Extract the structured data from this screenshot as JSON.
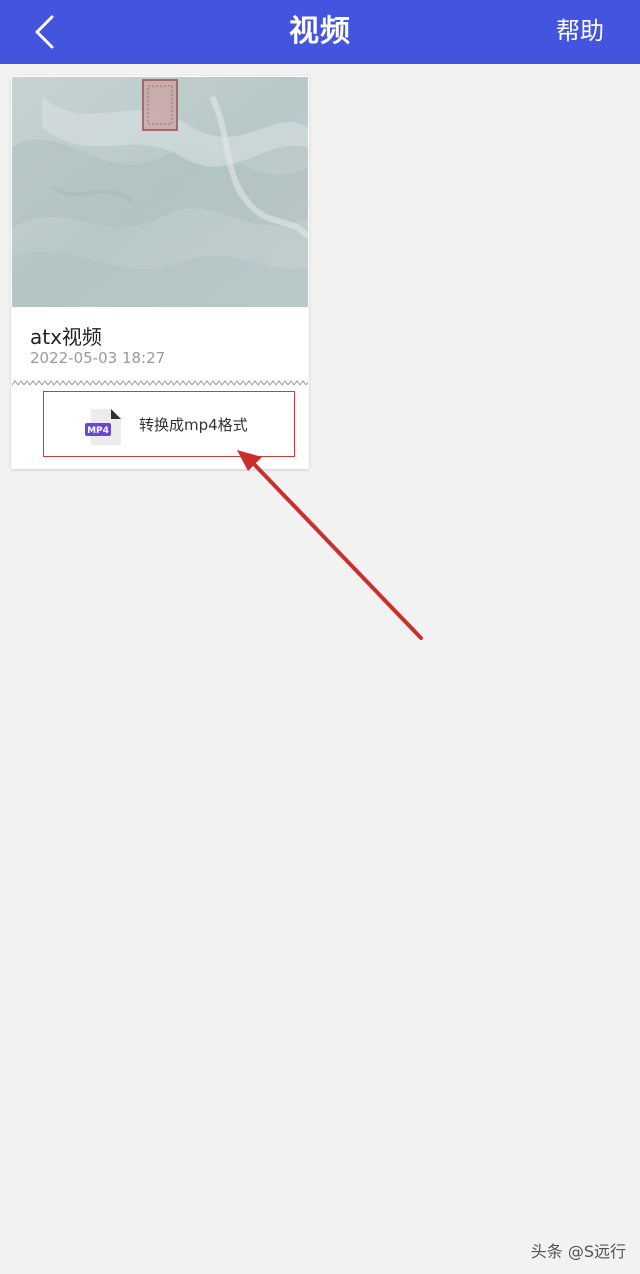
{
  "header": {
    "title": "视频",
    "help_label": "帮助",
    "back_icon": "chevron-left-icon",
    "bg_color": "#4355de"
  },
  "video_card": {
    "name": "atx视频",
    "date": "2022-05-03 18:27",
    "convert_label": "转换成mp4格式",
    "file_icon_text": "MP4",
    "file_icon": "mp4-file-icon"
  },
  "annotation": {
    "highlight_color": "#d23a3a"
  },
  "watermark": "头条 @S远行"
}
